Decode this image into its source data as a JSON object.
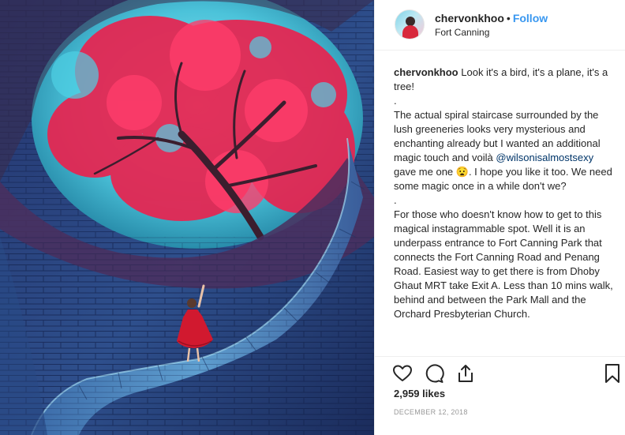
{
  "post": {
    "username": "chervonkhoo",
    "separator": "•",
    "follow_label": "Follow",
    "location": "Fort Canning"
  },
  "caption": {
    "username": "chervonkhoo",
    "line1": "Look it's a bird, it's a plane, it's a tree!",
    "dot1": ".",
    "para1": "The actual spiral staircase surrounded by the lush greeneries looks very mysterious and enchanting already but I wanted an additional magic touch and voilà",
    "mention": "@wilsonisalmostsexy",
    "para1_after": "gave me one 😧. I hope you like it too. We need some magic once in a while don't we?",
    "dot2": ".",
    "para2": "For those who doesn't know how to get to this magical instagrammable spot. Well it is an underpass entrance to Fort Canning Park that connects the Fort Canning Road and Penang Road. Easiest way to get there is from Dhoby Ghaut MRT take Exit A. Less than 10 mins walk, behind and between the Park Mall and the Orchard Presbyterian Church."
  },
  "actions": {
    "like_icon": "heart-icon",
    "comment_icon": "comment-icon",
    "share_icon": "share-icon",
    "save_icon": "bookmark-icon"
  },
  "likes": "2,959 likes",
  "date": "DECEMBER 12, 2018",
  "colors": {
    "accent": "#3897f0",
    "text": "#262626",
    "muted": "#999999",
    "border": "#efefef"
  }
}
